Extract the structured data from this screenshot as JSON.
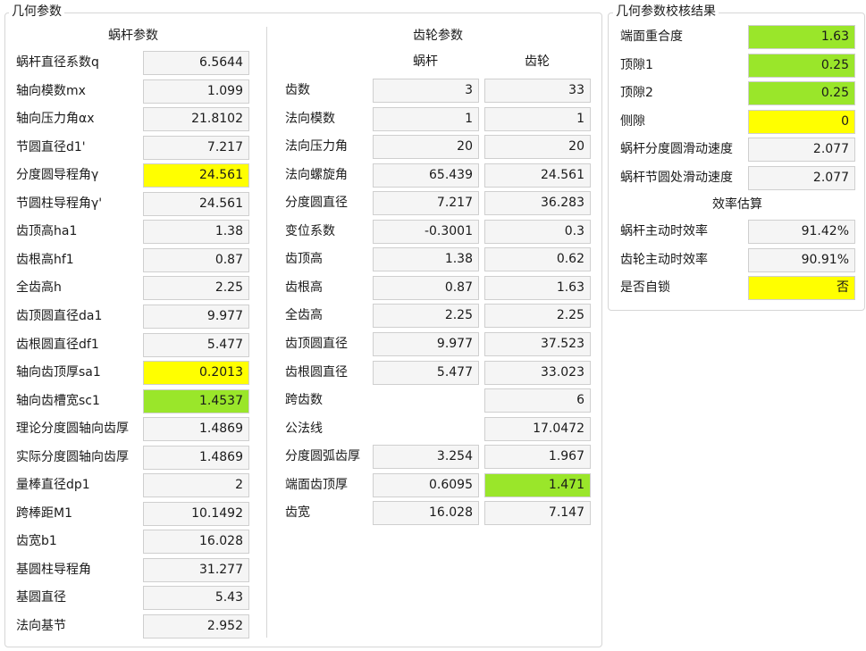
{
  "colors": {
    "yellow": "#ffff00",
    "green": "#9ae62a",
    "normal": "#f5f5f5"
  },
  "geometry": {
    "title": "几何参数",
    "worm": {
      "title": "蜗杆参数",
      "rows": [
        {
          "label": "蜗杆直径系数q",
          "value": "6.5644",
          "hl": ""
        },
        {
          "label": "轴向模数mx",
          "value": "1.099",
          "hl": ""
        },
        {
          "label": "轴向压力角αx",
          "value": "21.8102",
          "hl": ""
        },
        {
          "label": "节圆直径d1'",
          "value": "7.217",
          "hl": ""
        },
        {
          "label": "分度圆导程角γ",
          "value": "24.561",
          "hl": "yellow"
        },
        {
          "label": "节圆柱导程角γ'",
          "value": "24.561",
          "hl": ""
        },
        {
          "label": "齿顶高ha1",
          "value": "1.38",
          "hl": ""
        },
        {
          "label": "齿根高hf1",
          "value": "0.87",
          "hl": ""
        },
        {
          "label": "全齿高h",
          "value": "2.25",
          "hl": ""
        },
        {
          "label": "齿顶圆直径da1",
          "value": "9.977",
          "hl": ""
        },
        {
          "label": "齿根圆直径df1",
          "value": "5.477",
          "hl": ""
        },
        {
          "label": "轴向齿顶厚sa1",
          "value": "0.2013",
          "hl": "yellow"
        },
        {
          "label": "轴向齿槽宽sc1",
          "value": "1.4537",
          "hl": "green"
        },
        {
          "label": "理论分度圆轴向齿厚",
          "value": "1.4869",
          "hl": ""
        },
        {
          "label": "实际分度圆轴向齿厚",
          "value": "1.4869",
          "hl": ""
        },
        {
          "label": "量棒直径dp1",
          "value": "2",
          "hl": ""
        },
        {
          "label": "跨棒距M1",
          "value": "10.1492",
          "hl": ""
        },
        {
          "label": "齿宽b1",
          "value": "16.028",
          "hl": ""
        },
        {
          "label": "基圆柱导程角",
          "value": "31.277",
          "hl": ""
        },
        {
          "label": "基圆直径",
          "value": "5.43",
          "hl": ""
        },
        {
          "label": "法向基节",
          "value": "2.952",
          "hl": ""
        }
      ]
    },
    "gear": {
      "title": "齿轮参数",
      "col_worm": "蜗杆",
      "col_gear": "齿轮",
      "rows": [
        {
          "label": "齿数",
          "worm": "3",
          "gear": "33",
          "hl_w": "",
          "hl_g": ""
        },
        {
          "label": "法向模数",
          "worm": "1",
          "gear": "1",
          "hl_w": "",
          "hl_g": ""
        },
        {
          "label": "法向压力角",
          "worm": "20",
          "gear": "20",
          "hl_w": "",
          "hl_g": ""
        },
        {
          "label": "法向螺旋角",
          "worm": "65.439",
          "gear": "24.561",
          "hl_w": "",
          "hl_g": ""
        },
        {
          "label": "分度圆直径",
          "worm": "7.217",
          "gear": "36.283",
          "hl_w": "",
          "hl_g": ""
        },
        {
          "label": "变位系数",
          "worm": "-0.3001",
          "gear": "0.3",
          "hl_w": "",
          "hl_g": ""
        },
        {
          "label": "齿顶高",
          "worm": "1.38",
          "gear": "0.62",
          "hl_w": "",
          "hl_g": ""
        },
        {
          "label": "齿根高",
          "worm": "0.87",
          "gear": "1.63",
          "hl_w": "",
          "hl_g": ""
        },
        {
          "label": "全齿高",
          "worm": "2.25",
          "gear": "2.25",
          "hl_w": "",
          "hl_g": ""
        },
        {
          "label": "齿顶圆直径",
          "worm": "9.977",
          "gear": "37.523",
          "hl_w": "",
          "hl_g": ""
        },
        {
          "label": "齿根圆直径",
          "worm": "5.477",
          "gear": "33.023",
          "hl_w": "",
          "hl_g": ""
        },
        {
          "label": "跨齿数",
          "worm": null,
          "gear": "6",
          "hl_w": "",
          "hl_g": ""
        },
        {
          "label": "公法线",
          "worm": null,
          "gear": "17.0472",
          "hl_w": "",
          "hl_g": ""
        },
        {
          "label": "分度圆弧齿厚",
          "worm": "3.254",
          "gear": "1.967",
          "hl_w": "",
          "hl_g": ""
        },
        {
          "label": "端面齿顶厚",
          "worm": "0.6095",
          "gear": "1.471",
          "hl_w": "",
          "hl_g": "green"
        },
        {
          "label": "齿宽",
          "worm": "16.028",
          "gear": "7.147",
          "hl_w": "",
          "hl_g": ""
        }
      ]
    }
  },
  "check": {
    "title": "几何参数校核结果",
    "rows": [
      {
        "label": "端面重合度",
        "value": "1.63",
        "hl": "green"
      },
      {
        "label": "顶隙1",
        "value": "0.25",
        "hl": "green"
      },
      {
        "label": "顶隙2",
        "value": "0.25",
        "hl": "green"
      },
      {
        "label": "侧隙",
        "value": "0",
        "hl": "yellow"
      },
      {
        "label": "蜗杆分度圆滑动速度",
        "value": "2.077",
        "hl": ""
      },
      {
        "label": "蜗杆节圆处滑动速度",
        "value": "2.077",
        "hl": ""
      }
    ],
    "efficiency_title": "效率估算",
    "eff_rows": [
      {
        "label": "蜗杆主动时效率",
        "value": "91.42%",
        "hl": ""
      },
      {
        "label": "齿轮主动时效率",
        "value": "90.91%",
        "hl": ""
      },
      {
        "label": "是否自锁",
        "value": "否",
        "hl": "yellow"
      }
    ]
  }
}
